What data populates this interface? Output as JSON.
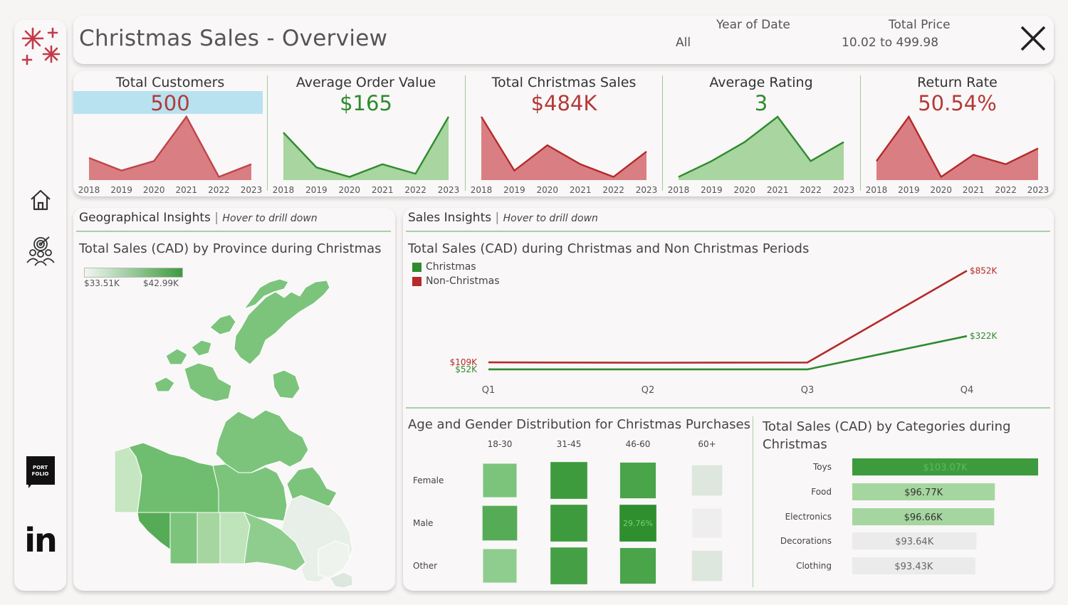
{
  "header": {
    "title": "Christmas Sales - Overview",
    "year_filter": {
      "label": "Year of Date",
      "value": "All"
    },
    "price_filter": {
      "label": "Total Price",
      "value": "10.02 to 499.98"
    }
  },
  "sidebar": {
    "portfolio_badge": {
      "line1": "PORT",
      "line2": "FOLIO"
    },
    "linkedin_text": "in"
  },
  "kpis": [
    {
      "title": "Total Customers",
      "value": "500",
      "color": "#b33a3a",
      "highlight": "#b8e2f0",
      "fill": "#d97f83",
      "stroke": "#c0444a"
    },
    {
      "title": "Average Order Value",
      "value": "$165",
      "color": "#2e8b2e",
      "fill": "#a8d5a0",
      "stroke": "#2e8b2e"
    },
    {
      "title": "Total Christmas Sales",
      "value": "$484K",
      "color": "#b33a3a",
      "fill": "#d97f83",
      "stroke": "#b52a2a"
    },
    {
      "title": "Average Rating",
      "value": "3",
      "color": "#2e8b2e",
      "fill": "#a8d5a0",
      "stroke": "#2e8b2e"
    },
    {
      "title": "Return Rate",
      "value": "50.54%",
      "color": "#b33a3a",
      "fill": "#d97f83",
      "stroke": "#b52a2a"
    }
  ],
  "geo": {
    "section_title": "Geographical Insights",
    "section_hint": "Hover to drill down",
    "chart_title": "Total Sales (CAD) by Province during Christmas",
    "legend_min": "$33.51K",
    "legend_max": "$42.99K"
  },
  "sales": {
    "section_title": "Sales Insights",
    "section_hint": "Hover to drill down",
    "line_title": "Total Sales (CAD) during Christmas and Non Christmas Periods",
    "heatmap_title": "Age and Gender Distribution for Christmas Purchases",
    "bar_title_line1": "Total Sales (CAD) by Categories during",
    "bar_title_line2": "Christmas"
  },
  "chart_data": [
    {
      "type": "area",
      "name": "Total Customers",
      "x": [
        "2018",
        "2019",
        "2020",
        "2021",
        "2022",
        "2023"
      ],
      "values": [
        0.35,
        0.15,
        0.3,
        1.0,
        0.05,
        0.25
      ],
      "color": "#c0444a"
    },
    {
      "type": "area",
      "name": "Average Order Value",
      "x": [
        "2018",
        "2019",
        "2020",
        "2021",
        "2022",
        "2023"
      ],
      "values": [
        0.75,
        0.2,
        0.05,
        0.25,
        0.1,
        1.0
      ],
      "color": "#2e8b2e"
    },
    {
      "type": "area",
      "name": "Total Christmas Sales",
      "x": [
        "2018",
        "2019",
        "2020",
        "2021",
        "2022",
        "2023"
      ],
      "values": [
        1.0,
        0.15,
        0.55,
        0.25,
        0.05,
        0.45
      ],
      "color": "#b52a2a"
    },
    {
      "type": "area",
      "name": "Average Rating",
      "x": [
        "2018",
        "2019",
        "2020",
        "2021",
        "2022",
        "2023"
      ],
      "values": [
        0.05,
        0.3,
        0.6,
        1.0,
        0.3,
        0.6
      ],
      "color": "#2e8b2e"
    },
    {
      "type": "area",
      "name": "Return Rate",
      "x": [
        "2018",
        "2019",
        "2020",
        "2021",
        "2022",
        "2023"
      ],
      "values": [
        0.3,
        1.0,
        0.05,
        0.4,
        0.25,
        0.5
      ],
      "color": "#b52a2a"
    },
    {
      "type": "line",
      "title": "Total Sales (CAD) during Christmas and Non Christmas Periods",
      "categories": [
        "Q1",
        "Q2",
        "Q3",
        "Q4"
      ],
      "series": [
        {
          "name": "Christmas",
          "values": [
            52,
            52,
            52,
            322
          ],
          "color": "#2e8b2e",
          "labels": {
            "0": "$52K",
            "3": "$322K"
          }
        },
        {
          "name": "Non-Christmas",
          "values": [
            109,
            106,
            108,
            852
          ],
          "color": "#b52a2a",
          "labels": {
            "0": "$109K",
            "3": "$852K"
          }
        }
      ],
      "ylim": [
        0,
        900
      ]
    },
    {
      "type": "heatmap",
      "title": "Age and Gender Distribution for Christmas Purchases",
      "columns": [
        "18-30",
        "31-45",
        "46-60",
        "60+"
      ],
      "rows": [
        "Female",
        "Male",
        "Other"
      ],
      "cells": [
        [
          {
            "size": 0.62,
            "color": "#7cc47c"
          },
          {
            "size": 0.68,
            "color": "#3d9b3d"
          },
          {
            "size": 0.66,
            "color": "#4aa44a"
          },
          {
            "size": 0.56,
            "color": "#dde7dd"
          }
        ],
        [
          {
            "size": 0.64,
            "color": "#56ac56"
          },
          {
            "size": 0.68,
            "color": "#3d9b3d"
          },
          {
            "size": 0.68,
            "color": "#2f8f2f",
            "label": "29.76%"
          },
          {
            "size": 0.54,
            "color": "#eeeeee"
          }
        ],
        [
          {
            "size": 0.62,
            "color": "#8fcd8f"
          },
          {
            "size": 0.68,
            "color": "#45a045"
          },
          {
            "size": 0.66,
            "color": "#4aa44a"
          },
          {
            "size": 0.56,
            "color": "#dde7dd"
          }
        ]
      ]
    },
    {
      "type": "bar",
      "title": "Total Sales (CAD) by Categories during Christmas",
      "categories": [
        "Toys",
        "Food",
        "Electronics",
        "Decorations",
        "Clothing"
      ],
      "values": [
        103.07,
        96.77,
        96.66,
        93.64,
        93.43
      ],
      "labels": [
        "$103.07K",
        "$96.77K",
        "$96.66K",
        "$93.64K",
        "$93.43K"
      ],
      "colors": [
        "#3d9b3d",
        "#a6d6a0",
        "#a6d6a0",
        "#ebebeb",
        "#ebebeb"
      ],
      "label_colors": [
        "#5fb85f",
        "#333333",
        "#333333",
        "#666666",
        "#666666"
      ]
    }
  ]
}
